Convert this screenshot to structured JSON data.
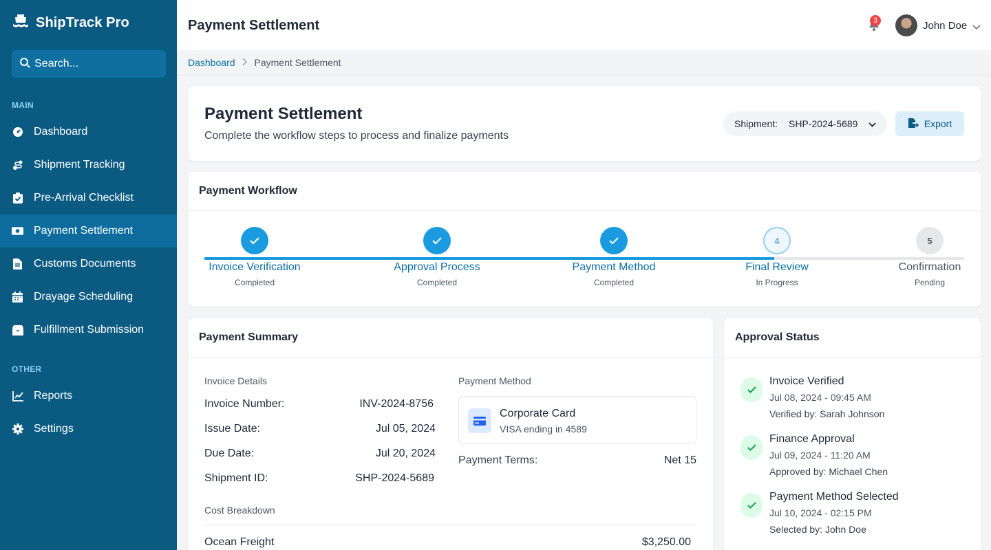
{
  "app": {
    "name": "ShipTrack Pro"
  },
  "search": {
    "placeholder": "Search..."
  },
  "sidebar": {
    "section_main": "MAIN",
    "section_other": "OTHER",
    "items": [
      {
        "label": "Dashboard",
        "icon": "gauge-icon"
      },
      {
        "label": "Shipment Tracking",
        "icon": "route-icon"
      },
      {
        "label": "Pre-Arrival Checklist",
        "icon": "clipboard-check-icon"
      },
      {
        "label": "Payment Settlement",
        "icon": "money-icon",
        "active": true
      },
      {
        "label": "Customs Documents",
        "icon": "document-icon"
      },
      {
        "label": "Drayage Scheduling",
        "icon": "calendar-icon"
      },
      {
        "label": "Fulfillment Submission",
        "icon": "box-icon"
      }
    ],
    "other_items": [
      {
        "label": "Reports",
        "icon": "chart-line-icon"
      },
      {
        "label": "Settings",
        "icon": "gear-icon"
      }
    ]
  },
  "topbar": {
    "title": "Payment Settlement",
    "notifications": "3",
    "user_name": "John Doe"
  },
  "breadcrumb": {
    "home": "Dashboard",
    "current": "Payment Settlement"
  },
  "header": {
    "title": "Payment Settlement",
    "subtitle": "Complete the workflow steps to process and finalize payments",
    "shipment_label": "Shipment:",
    "shipment_value": "SHP-2024-5689",
    "export_label": "Export"
  },
  "workflow": {
    "title": "Payment Workflow",
    "progress": 0.75,
    "steps": [
      {
        "label": "Invoice Verification",
        "status": "Completed",
        "state": "done",
        "num": "1"
      },
      {
        "label": "Approval Process",
        "status": "Completed",
        "state": "done",
        "num": "2"
      },
      {
        "label": "Payment Method",
        "status": "Completed",
        "state": "done",
        "num": "3"
      },
      {
        "label": "Final Review",
        "status": "In Progress",
        "state": "current",
        "num": "4"
      },
      {
        "label": "Confirmation",
        "status": "Pending",
        "state": "pending",
        "num": "5"
      }
    ],
    "colors": {
      "active": "#1a9be0",
      "pending": "#e5e7eb"
    }
  },
  "summary": {
    "title": "Payment Summary",
    "invoice_details_label": "Invoice Details",
    "invoice": [
      {
        "key": "Invoice Number:",
        "value": "INV-2024-8756"
      },
      {
        "key": "Issue Date:",
        "value": "Jul 05, 2024"
      },
      {
        "key": "Due Date:",
        "value": "Jul 20, 2024"
      },
      {
        "key": "Shipment ID:",
        "value": "SHP-2024-5689"
      }
    ],
    "payment_method_label": "Payment Method",
    "card_title": "Corporate Card",
    "card_sub": "VISA ending in 4589",
    "terms_key": "Payment Terms:",
    "terms_value": "Net 15",
    "cost_breakdown_label": "Cost Breakdown",
    "costs": [
      {
        "key": "Ocean Freight",
        "value": "$3,250.00"
      }
    ]
  },
  "approval": {
    "title": "Approval Status",
    "items": [
      {
        "title": "Invoice Verified",
        "date": "Jul 08, 2024 - 09:45 AM",
        "by": "Verified by: Sarah Johnson"
      },
      {
        "title": "Finance Approval",
        "date": "Jul 09, 2024 - 11:20 AM",
        "by": "Approved by: Michael Chen"
      },
      {
        "title": "Payment Method Selected",
        "date": "Jul 10, 2024 - 02:15 PM",
        "by": "Selected by: John Doe"
      }
    ]
  }
}
